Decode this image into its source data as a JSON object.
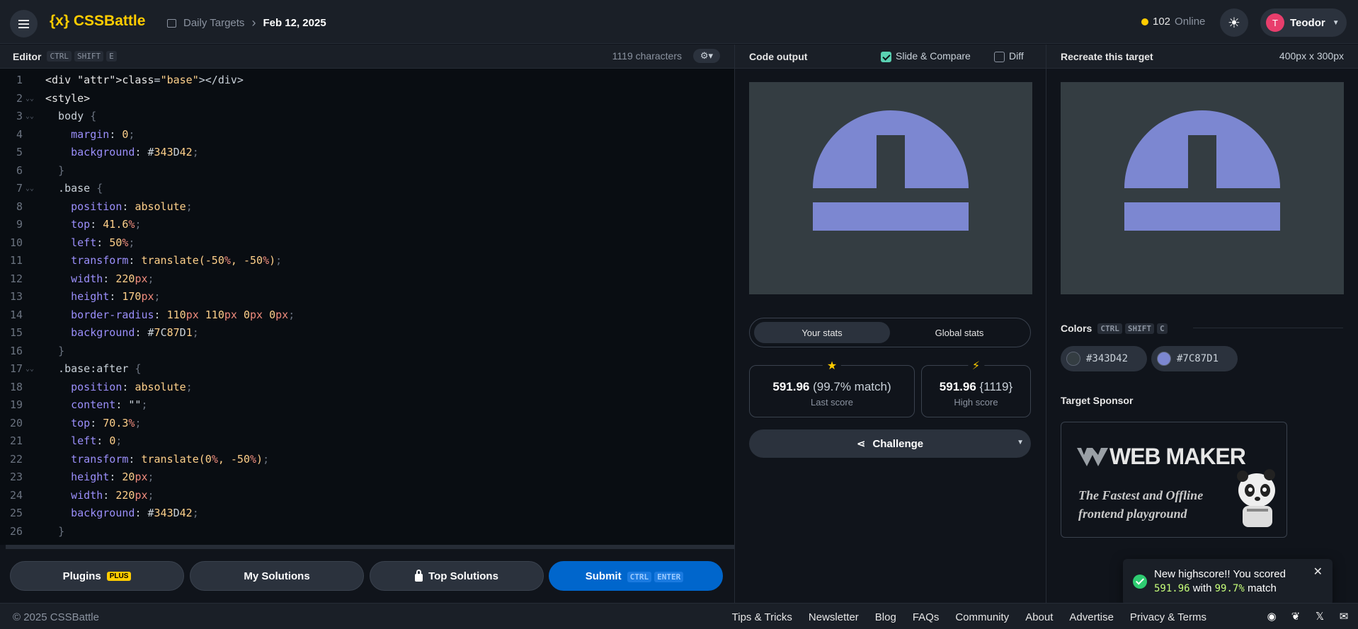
{
  "header": {
    "logo": "{x} CSSBattle",
    "breadcrumb_section": "Daily Targets",
    "breadcrumb_date": "Feb 12, 2025",
    "online_count": "102",
    "online_label": "Online",
    "user_initial": "T",
    "user_name": "Teodor"
  },
  "editor": {
    "title": "Editor",
    "shortcut": [
      "CTRL",
      "SHIFT",
      "E"
    ],
    "char_count": "1119 characters"
  },
  "output": {
    "title": "Code output",
    "slide_compare": "Slide & Compare",
    "diff": "Diff",
    "tab_your": "Your stats",
    "tab_global": "Global stats",
    "last_score": "591.96",
    "last_match": "(99.7% match)",
    "last_label": "Last score",
    "high_score": "591.96",
    "high_chars": "{1119}",
    "high_label": "High score",
    "challenge": "Challenge"
  },
  "target": {
    "title": "Recreate this target",
    "size": "400px x 300px",
    "colors_title": "Colors",
    "colors_shortcut": [
      "CTRL",
      "SHIFT",
      "C"
    ],
    "colors": [
      "#343D42",
      "#7C87D1"
    ],
    "sponsor_title": "Target Sponsor",
    "sponsor_name": "WEB MAKER",
    "sponsor_tagline": "The Fastest and Offline\nfrontend playground"
  },
  "actions": {
    "plugins": "Plugins",
    "plus": "PLUS",
    "my_solutions": "My Solutions",
    "top_solutions": "Top Solutions",
    "submit": "Submit",
    "submit_keys": [
      "CTRL",
      "ENTER"
    ]
  },
  "toast": {
    "line1": "New highscore!! You scored",
    "score": "591.96",
    "with": "with",
    "match": "99.7%",
    "match_word": "match"
  },
  "footer": {
    "copyright": "© 2025 CSSBattle",
    "links": [
      "Tips & Tricks",
      "Newsletter",
      "Blog",
      "FAQs",
      "Community",
      "About",
      "Advertise",
      "Privacy & Terms"
    ]
  },
  "colors": {
    "accent": "#FFCC00",
    "submit": "#0066CC",
    "canvas_bg": "#343D42",
    "shape": "#7C87D1"
  },
  "code_lines": [
    "<div class=\"base\"></div>",
    "<style>",
    "  body {",
    "    margin: 0;",
    "    background: #343D42;",
    "  }",
    "  .base {",
    "    position: absolute;",
    "    top: 41.6%;",
    "    left: 50%;",
    "    transform: translate(-50%, -50%);",
    "    width: 220px;",
    "    height: 170px;",
    "    border-radius: 110px 110px 0px 0px;",
    "    background: #7C87D1;",
    "  }",
    "  .base:after {",
    "    position: absolute;",
    "    content: \"\";",
    "    top: 70.3%;",
    "    left: 0;",
    "    transform: translate(0%, -50%);",
    "    height: 20px;",
    "    width: 220px;",
    "    background: #343D42;",
    "  }"
  ]
}
